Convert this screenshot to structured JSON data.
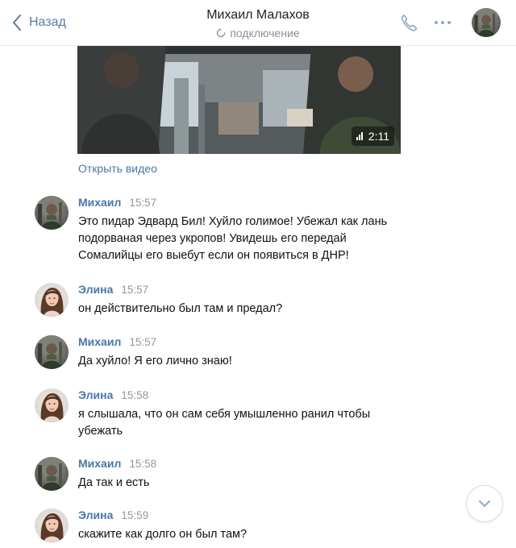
{
  "header": {
    "back_label": "Назад",
    "contact_name": "Михаил Малахов",
    "status": "подключение"
  },
  "video": {
    "duration": "2:11",
    "open_label": "Открыть видео"
  },
  "messages": [
    {
      "sender": "Михаил",
      "time": "15:57",
      "avatar": "mikhail",
      "lines": [
        "Это пидар Эдвард Бил! Хуйло голимое! Убежал как лань",
        "подорваная через укропов! Увидешь его передай",
        "Сомалийцы его выебут если он появиться в ДНР!"
      ]
    },
    {
      "sender": "Элина",
      "time": "15:57",
      "avatar": "elina",
      "lines": [
        "он действительно был там и предал?"
      ]
    },
    {
      "sender": "Михаил",
      "time": "15:57",
      "avatar": "mikhail",
      "lines": [
        "Да хуйло! Я его лично знаю!"
      ]
    },
    {
      "sender": "Элина",
      "time": "15:58",
      "avatar": "elina",
      "lines": [
        "я слышала, что он сам себя умышленно ранил чтобы",
        "убежать"
      ]
    },
    {
      "sender": "Михаил",
      "time": "15:58",
      "avatar": "mikhail",
      "lines": [
        "Да так и есть"
      ]
    },
    {
      "sender": "Элина",
      "time": "15:59",
      "avatar": "elina",
      "lines": [
        "скажите как долго он был там?"
      ]
    }
  ],
  "icons": {
    "back": "chevron-left-icon",
    "phone": "phone-icon",
    "more": "more-horizontal-icon",
    "spinner": "loading-spinner-icon",
    "signal": "signal-bars-icon",
    "scroll": "chevron-down-icon"
  },
  "colors": {
    "accent": "#4a76a8",
    "muted": "#93969b",
    "header_border": "#e7e8ec"
  }
}
